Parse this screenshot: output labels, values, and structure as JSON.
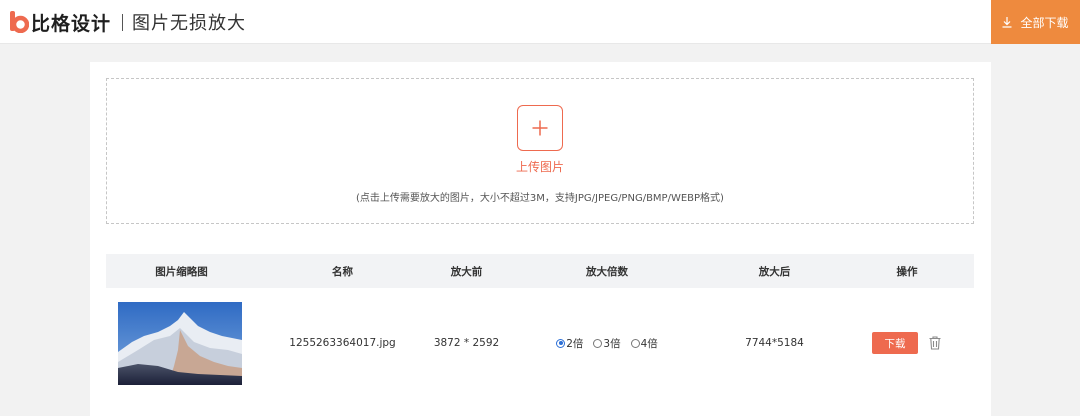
{
  "header": {
    "brand": "比格设计",
    "title": "图片无损放大",
    "download_all_label": "全部下载"
  },
  "upload": {
    "label": "上传图片",
    "hint": "(点击上传需要放大的图片，大小不超过3M，支持JPG/JPEG/PNG/BMP/WEBP格式)"
  },
  "table": {
    "columns": [
      "图片缩略图",
      "名称",
      "放大前",
      "放大倍数",
      "放大后",
      "操作"
    ],
    "rows": [
      {
        "thumbnail": "mountain-snow-peak-image",
        "name": "1255263364017.jpg",
        "before": "3872 * 2592",
        "scale_options": [
          "2倍",
          "3倍",
          "4倍"
        ],
        "selected_scale": "2倍",
        "after": "7744*5184",
        "download_label": "下载"
      }
    ]
  },
  "colors": {
    "accent": "#ee6a4f",
    "download_all_bg": "#ee8a3e",
    "page_bg": "#f2f2f2",
    "header_row_bg": "#f2f3f5"
  },
  "icons": [
    "logo-b-icon",
    "download-icon",
    "plus-icon",
    "trash-icon"
  ]
}
